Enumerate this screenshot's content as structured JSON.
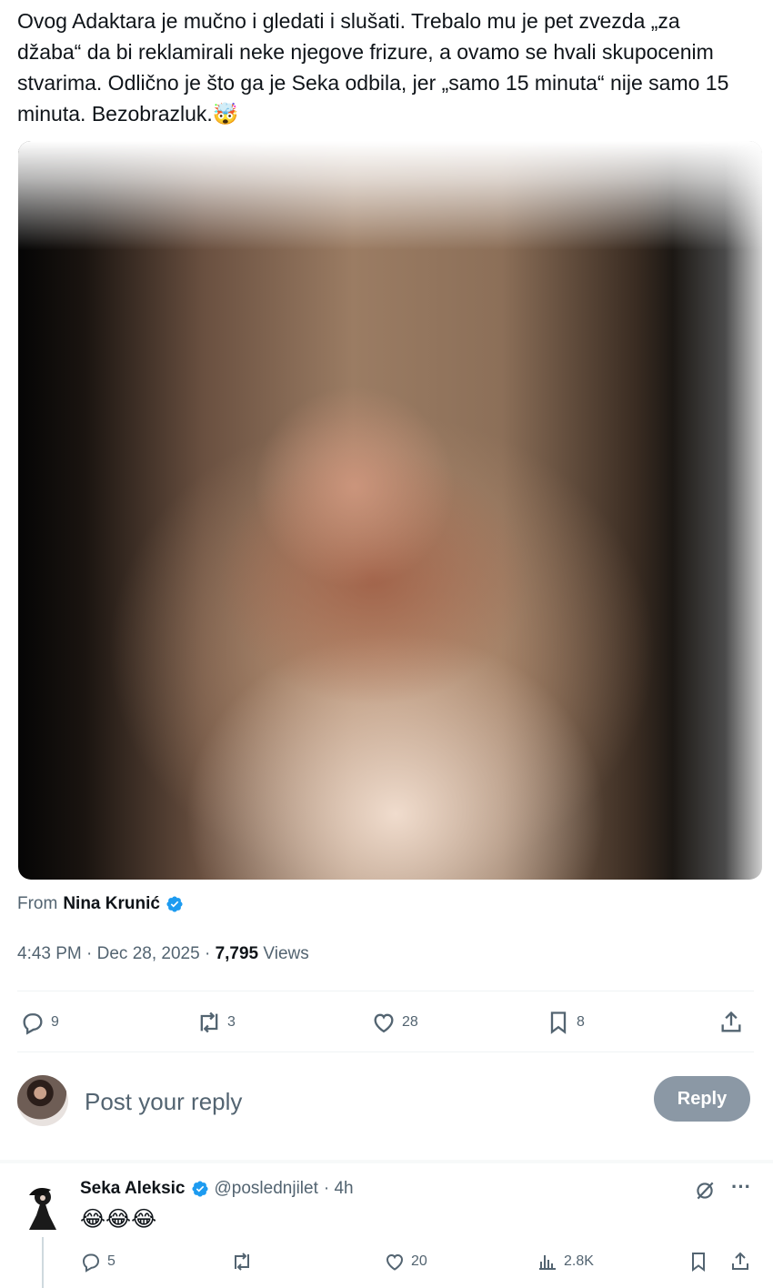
{
  "tweet": {
    "text": "Ovog Adaktara je mučno i gledati i slušati. Trebalo mu je pet zvezda „za džaba“ da bi reklamirali neke njegove frizure, a ovamo se hvali skupocenim stvarima. Odlično je što ga je Seka odbila, jer „samo 15 minuta“ nije samo 15 minuta. Bezobrazluk.🤯",
    "from_prefix": "From",
    "from_author": "Nina Krunić",
    "time": "4:43 PM · Dec 28, 2025 · ",
    "views_count": "7,795",
    "views_label": " Views",
    "stats": {
      "replies": "9",
      "reposts": "3",
      "likes": "28",
      "bookmarks": "8"
    }
  },
  "composer": {
    "placeholder": "Post your reply",
    "button_label": "Reply"
  },
  "reply": {
    "name": "Seka Aleksic",
    "handle": "@poslednjilet",
    "time": "· 4h",
    "text": "😂😂😂",
    "stats": {
      "replies": "5",
      "reposts": "",
      "likes": "20",
      "views": "2.8K"
    },
    "more_label": "···"
  },
  "colors": {
    "verified": "#1d9bf0",
    "secondary_text": "#536471",
    "primary_text": "#0f1419",
    "reply_button_disabled": "#8b98a5"
  },
  "icons": [
    "reply-icon",
    "repost-icon",
    "like-icon",
    "bookmark-icon",
    "share-icon",
    "views-icon",
    "grok-icon",
    "more-icon",
    "verified-badge-icon"
  ]
}
